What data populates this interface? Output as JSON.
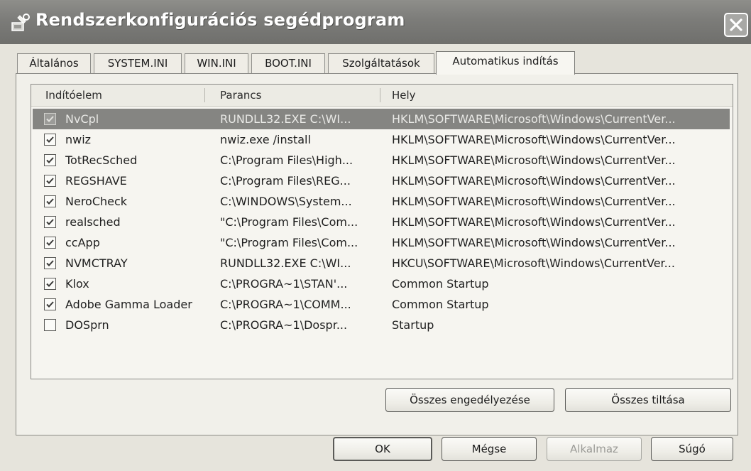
{
  "window": {
    "title": "Rendszerkonfigurációs segédprogram"
  },
  "tabs": [
    {
      "label": "Általános",
      "active": false
    },
    {
      "label": "SYSTEM.INI",
      "active": false
    },
    {
      "label": "WIN.INI",
      "active": false
    },
    {
      "label": "BOOT.INI",
      "active": false
    },
    {
      "label": "Szolgáltatások",
      "active": false
    },
    {
      "label": "Automatikus indítás",
      "active": true
    }
  ],
  "startup_list": {
    "columns": [
      "Indítóelem",
      "Parancs",
      "Hely"
    ],
    "rows": [
      {
        "checked": true,
        "selected": true,
        "item": "NvCpl",
        "command": "RUNDLL32.EXE C:\\WI...",
        "location": "HKLM\\SOFTWARE\\Microsoft\\Windows\\CurrentVer..."
      },
      {
        "checked": true,
        "selected": false,
        "item": "nwiz",
        "command": "nwiz.exe /install",
        "location": "HKLM\\SOFTWARE\\Microsoft\\Windows\\CurrentVer..."
      },
      {
        "checked": true,
        "selected": false,
        "item": "TotRecSched",
        "command": "C:\\Program Files\\High...",
        "location": "HKLM\\SOFTWARE\\Microsoft\\Windows\\CurrentVer..."
      },
      {
        "checked": true,
        "selected": false,
        "item": "REGSHAVE",
        "command": "C:\\Program Files\\REG...",
        "location": "HKLM\\SOFTWARE\\Microsoft\\Windows\\CurrentVer..."
      },
      {
        "checked": true,
        "selected": false,
        "item": "NeroCheck",
        "command": "C:\\WINDOWS\\System...",
        "location": "HKLM\\SOFTWARE\\Microsoft\\Windows\\CurrentVer..."
      },
      {
        "checked": true,
        "selected": false,
        "item": "realsched",
        "command": "\"C:\\Program Files\\Com...",
        "location": "HKLM\\SOFTWARE\\Microsoft\\Windows\\CurrentVer..."
      },
      {
        "checked": true,
        "selected": false,
        "item": "ccApp",
        "command": "\"C:\\Program Files\\Com...",
        "location": "HKLM\\SOFTWARE\\Microsoft\\Windows\\CurrentVer..."
      },
      {
        "checked": true,
        "selected": false,
        "item": "NVMCTRAY",
        "command": "RUNDLL32.EXE C:\\WI...",
        "location": "HKCU\\SOFTWARE\\Microsoft\\Windows\\CurrentVer..."
      },
      {
        "checked": true,
        "selected": false,
        "item": "Klox",
        "command": "C:\\PROGRA~1\\STAN'...",
        "location": "Common Startup"
      },
      {
        "checked": true,
        "selected": false,
        "item": "Adobe Gamma Loader",
        "command": "C:\\PROGRA~1\\COMM...",
        "location": "Common Startup"
      },
      {
        "checked": false,
        "selected": false,
        "item": "DOSprn",
        "command": "C:\\PROGRA~1\\Dospr...",
        "location": "Startup"
      }
    ]
  },
  "panel_buttons": {
    "enable_all": "Összes engedélyezése",
    "disable_all": "Összes tiltása"
  },
  "dialog_buttons": {
    "ok": "OK",
    "cancel": "Mégse",
    "apply": "Alkalmaz",
    "help": "Súgó"
  },
  "icons": {
    "title": "system-config-icon",
    "close": "close-icon",
    "check": "checkmark-icon"
  },
  "colors": {
    "titlebar": "#7c7c79",
    "selection": "#858582",
    "window": "#e6e4dc"
  }
}
